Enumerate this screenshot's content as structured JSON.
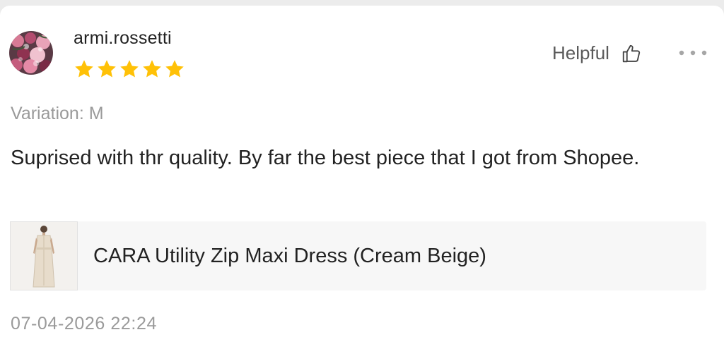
{
  "review": {
    "username": "armi.rossetti",
    "rating": 5,
    "max_rating": 5,
    "helpful_label": "Helpful",
    "variation": "Variation: M",
    "text": "Suprised with thr quality. By far the best piece that I got from Shopee.",
    "timestamp": "07-04-2026 22:24"
  },
  "product": {
    "name": "CARA Utility Zip Maxi Dress (Cream Beige)"
  },
  "icons": {
    "avatar": "avatar-floral-photo",
    "star": "star-icon",
    "helpful": "thumbs-up-icon",
    "more": "more-horizontal-icon"
  },
  "colors": {
    "star": "#FFC107",
    "text_primary": "#222222",
    "text_secondary": "#9A9A9A"
  }
}
